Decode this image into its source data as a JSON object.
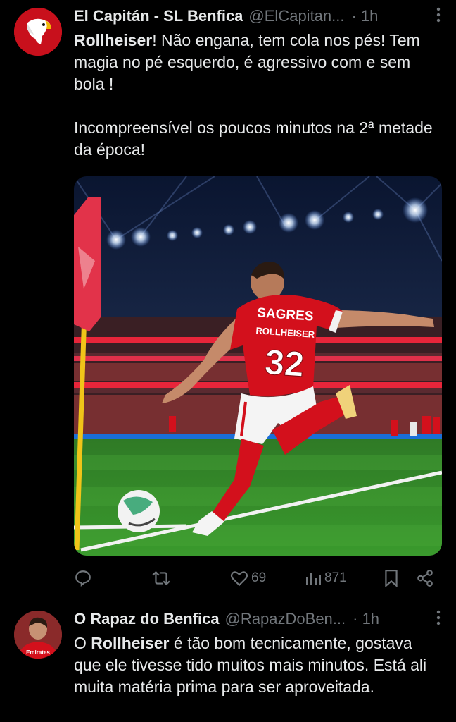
{
  "tweets": [
    {
      "name": "El Capitán - SL Benfica",
      "handle": "@ElCapitan...",
      "time": "· 1h",
      "text_bold": "Rollheiser",
      "text_rest": "! Não engana, tem cola nos pés! Tem magia no pé esquerdo, é agressivo com e sem bola !",
      "text_para2": "Incompreensível os poucos minutos na 2ª metade da época!",
      "media": {
        "jersey_sponsor": "SAGRES",
        "jersey_name": "ROLLHEISER",
        "jersey_number": "32"
      },
      "actions": {
        "reply_count": "",
        "retweet_count": "",
        "like_count": "69",
        "views_count": "871"
      }
    },
    {
      "name": "O Rapaz do Benfica",
      "handle": "@RapazDoBen...",
      "time": "· 1h",
      "text_prefix": "O ",
      "text_bold": "Rollheiser",
      "text_rest": " é tão bom tecnicamente, gostava que ele tivesse tido muitos mais minutos. Está ali muita matéria prima para ser aproveitada.",
      "avatar_text": "Emirates"
    }
  ],
  "colors": {
    "text": "#e7e9ea",
    "muted": "#71767b",
    "benfica_red": "#d3101c",
    "divider": "#2f3336"
  }
}
